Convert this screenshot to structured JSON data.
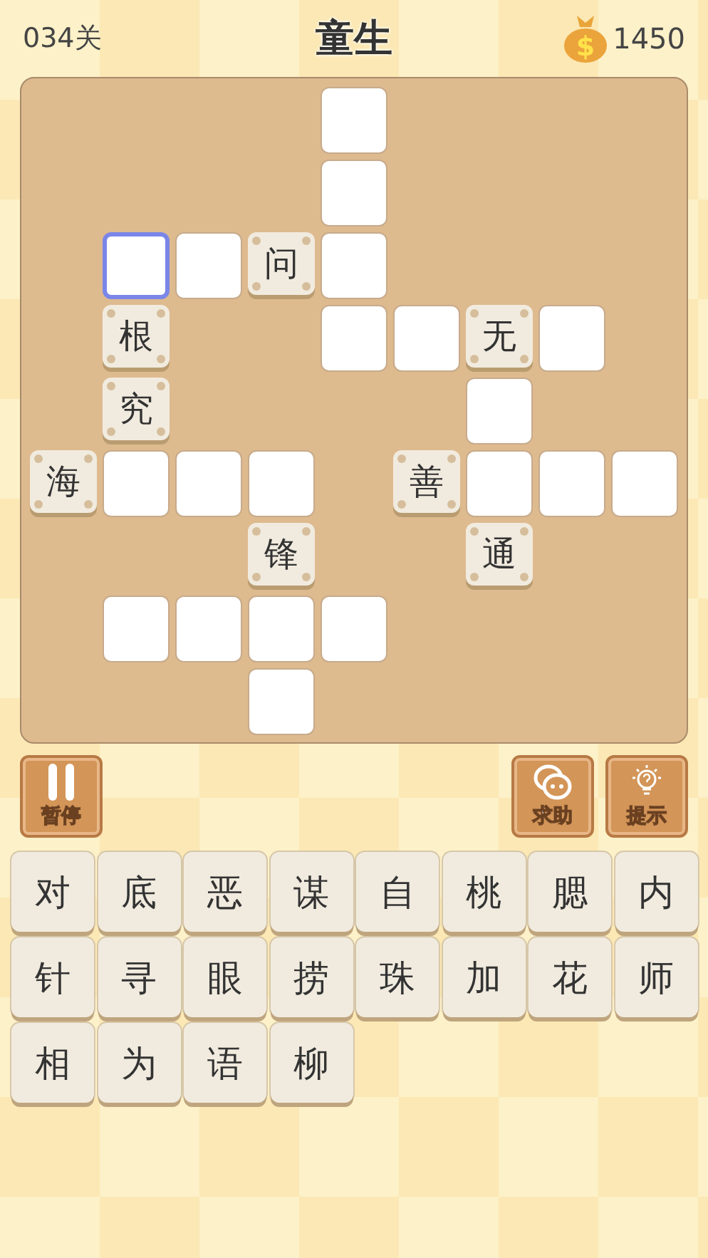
{
  "header": {
    "level": "034关",
    "title": "童生",
    "coins": "1450",
    "coin_symbol": "$"
  },
  "board": {
    "rows": [
      [
        {
          "kind": "gap"
        },
        {
          "kind": "gap"
        },
        {
          "kind": "gap"
        },
        {
          "kind": "gap"
        },
        {
          "kind": "blank",
          "selected": false
        },
        {
          "kind": "gap"
        },
        {
          "kind": "gap"
        },
        {
          "kind": "gap"
        },
        {
          "kind": "gap"
        }
      ],
      [
        {
          "kind": "gap"
        },
        {
          "kind": "gap"
        },
        {
          "kind": "gap"
        },
        {
          "kind": "gap"
        },
        {
          "kind": "blank",
          "selected": false
        },
        {
          "kind": "gap"
        },
        {
          "kind": "gap"
        },
        {
          "kind": "gap"
        },
        {
          "kind": "gap"
        }
      ],
      [
        {
          "kind": "gap"
        },
        {
          "kind": "blank",
          "selected": true
        },
        {
          "kind": "blank",
          "selected": false
        },
        {
          "kind": "tile",
          "text": "问"
        },
        {
          "kind": "blank",
          "selected": false
        },
        {
          "kind": "gap"
        },
        {
          "kind": "gap"
        },
        {
          "kind": "gap"
        },
        {
          "kind": "gap"
        }
      ],
      [
        {
          "kind": "gap"
        },
        {
          "kind": "tile",
          "text": "根"
        },
        {
          "kind": "gap"
        },
        {
          "kind": "gap"
        },
        {
          "kind": "blank",
          "selected": false
        },
        {
          "kind": "blank",
          "selected": false
        },
        {
          "kind": "tile",
          "text": "无"
        },
        {
          "kind": "blank",
          "selected": false
        },
        {
          "kind": "gap"
        }
      ],
      [
        {
          "kind": "gap"
        },
        {
          "kind": "tile",
          "text": "究"
        },
        {
          "kind": "gap"
        },
        {
          "kind": "gap"
        },
        {
          "kind": "gap"
        },
        {
          "kind": "gap"
        },
        {
          "kind": "blank",
          "selected": false
        },
        {
          "kind": "gap"
        },
        {
          "kind": "gap"
        }
      ],
      [
        {
          "kind": "tile",
          "text": "海"
        },
        {
          "kind": "blank",
          "selected": false
        },
        {
          "kind": "blank",
          "selected": false
        },
        {
          "kind": "blank",
          "selected": false
        },
        {
          "kind": "gap"
        },
        {
          "kind": "tile",
          "text": "善"
        },
        {
          "kind": "blank",
          "selected": false
        },
        {
          "kind": "blank",
          "selected": false
        },
        {
          "kind": "blank",
          "selected": false
        }
      ],
      [
        {
          "kind": "gap"
        },
        {
          "kind": "gap"
        },
        {
          "kind": "gap"
        },
        {
          "kind": "tile",
          "text": "锋"
        },
        {
          "kind": "gap"
        },
        {
          "kind": "gap"
        },
        {
          "kind": "tile",
          "text": "通"
        },
        {
          "kind": "gap"
        },
        {
          "kind": "gap"
        }
      ],
      [
        {
          "kind": "gap"
        },
        {
          "kind": "blank",
          "selected": false
        },
        {
          "kind": "blank",
          "selected": false
        },
        {
          "kind": "blank",
          "selected": false
        },
        {
          "kind": "blank",
          "selected": false
        },
        {
          "kind": "gap"
        },
        {
          "kind": "gap"
        },
        {
          "kind": "gap"
        },
        {
          "kind": "gap"
        }
      ],
      [
        {
          "kind": "gap"
        },
        {
          "kind": "gap"
        },
        {
          "kind": "gap"
        },
        {
          "kind": "blank",
          "selected": false
        },
        {
          "kind": "gap"
        },
        {
          "kind": "gap"
        },
        {
          "kind": "gap"
        },
        {
          "kind": "gap"
        },
        {
          "kind": "gap"
        }
      ]
    ]
  },
  "left_buttons": [
    {
      "kind": "pause",
      "label": "暂停"
    }
  ],
  "right_buttons": [
    {
      "kind": "help",
      "label": "求助"
    },
    {
      "kind": "hint",
      "label": "提示"
    }
  ],
  "letters": [
    "对",
    "底",
    "恶",
    "谋",
    "自",
    "桃",
    "腮",
    "内",
    "针",
    "寻",
    "眼",
    "捞",
    "珠",
    "加",
    "花",
    "师",
    "相",
    "为",
    "语",
    "柳"
  ]
}
